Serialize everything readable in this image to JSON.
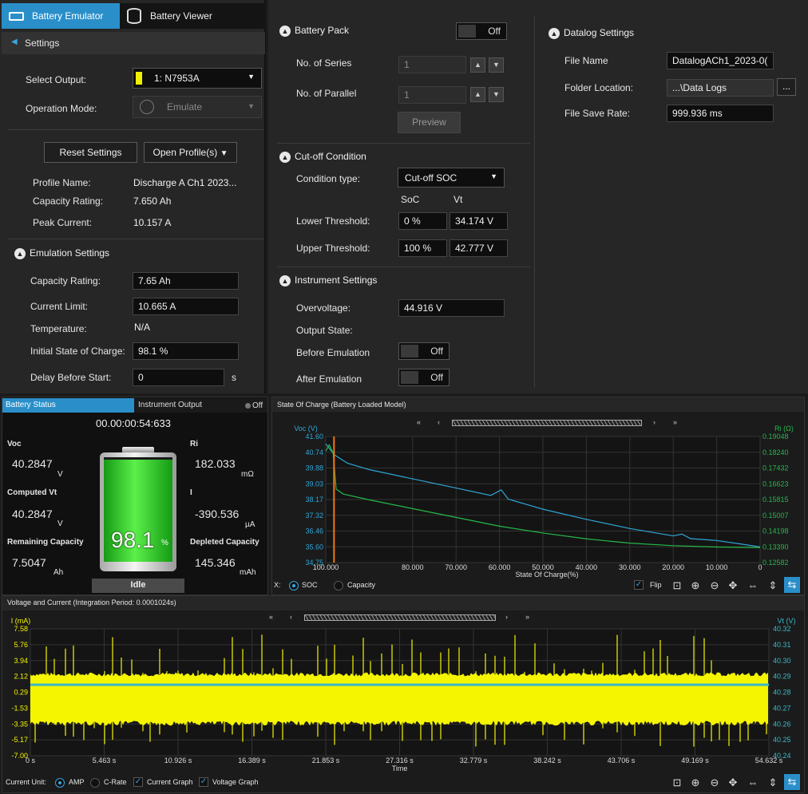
{
  "tabs": {
    "emulator": "Battery Emulator",
    "viewer": "Battery Viewer"
  },
  "settings": {
    "title": "Settings",
    "select_output_label": "Select Output:",
    "select_output_value": "1: N7953A",
    "operation_mode_label": "Operation Mode:",
    "operation_mode_value": "Emulate",
    "reset_button": "Reset Settings",
    "open_profiles_button": "Open Profile(s)",
    "profile_name_label": "Profile Name:",
    "profile_name_value": "Discharge A Ch1 2023...",
    "capacity_rating_label": "Capacity Rating:",
    "capacity_rating_value": "7.650 Ah",
    "peak_current_label": "Peak Current:",
    "peak_current_value": "10.157 A"
  },
  "emulation": {
    "title": "Emulation Settings",
    "capacity_label": "Capacity Rating:",
    "capacity_value": "7.65 Ah",
    "current_limit_label": "Current Limit:",
    "current_limit_value": "10.665 A",
    "temperature_label": "Temperature:",
    "temperature_value": "N/A",
    "initial_soc_label": "Initial State of Charge:",
    "initial_soc_value": "98.1 %",
    "delay_label": "Delay Before Start:",
    "delay_value": "0",
    "delay_unit": "s"
  },
  "pack": {
    "title": "Battery Pack",
    "toggle": "Off",
    "series_label": "No. of Series",
    "series_value": "1",
    "parallel_label": "No. of Parallel",
    "parallel_value": "1",
    "preview_button": "Preview"
  },
  "cutoff": {
    "title": "Cut-off Condition",
    "condition_label": "Condition type:",
    "condition_value": "Cut-off SOC",
    "soc_header": "SoC",
    "vt_header": "Vt",
    "lower_label": "Lower Threshold:",
    "lower_soc": "0 %",
    "lower_vt": "34.174 V",
    "upper_label": "Upper Threshold:",
    "upper_soc": "100 %",
    "upper_vt": "42.777 V"
  },
  "instrument": {
    "title": "Instrument Settings",
    "overvoltage_label": "Overvoltage:",
    "overvoltage_value": "44.916 V",
    "output_state_label": "Output State:",
    "before_label": "Before Emulation",
    "before_value": "Off",
    "after_label": "After Emulation",
    "after_value": "Off"
  },
  "datalog": {
    "title": "Datalog Settings",
    "file_name_label": "File Name",
    "file_name_value": "DatalogACh1_2023-0(",
    "folder_label": "Folder Location:",
    "folder_value": "...\\Data Logs",
    "browse_button": "...",
    "rate_label": "File Save Rate:",
    "rate_value": "999.936 ms"
  },
  "status": {
    "tab_status": "Battery Status",
    "tab_instrument": "Instrument Output",
    "off_label": "Off",
    "timer": "00.00:00:54:633",
    "voc_label": "Voc",
    "voc_value": "40.2847",
    "voc_unit": "V",
    "cvt_label": "Computed Vt",
    "cvt_value": "40.2847",
    "cvt_unit": "V",
    "rem_label": "Remaining Capacity",
    "rem_value": "7.5047",
    "rem_unit": "Ah",
    "ri_label": "Ri",
    "ri_value": "182.033",
    "ri_unit": "mΩ",
    "i_label": "I",
    "i_value": "-390.536",
    "i_unit": "µA",
    "dep_label": "Depleted Capacity",
    "dep_value": "145.346",
    "dep_unit": "mAh",
    "soc_percent": "98.1",
    "soc_sign": "%",
    "soc_fill": 0.981,
    "state": "Idle"
  },
  "soc_chart": {
    "title": "State Of Charge (Battery Loaded Model)",
    "left_axis": "Voc (V)",
    "right_axis": "Ri (Ω)",
    "x_title": "State Of Charge(%)",
    "x_label": "X:",
    "opt_soc": "SOC",
    "opt_capacity": "Capacity",
    "flip_label": "Flip"
  },
  "vi_chart": {
    "title": "Voltage and Current (Integration Period: 0.0001024s)",
    "left_axis": "I (mA)",
    "right_axis": "Vt (V)",
    "x_title": "Time",
    "unit_label": "Current Unit:",
    "opt_amp": "AMP",
    "opt_crate": "C-Rate",
    "chk_current": "Current Graph",
    "chk_voltage": "Voltage Graph"
  },
  "colors": {
    "accent": "#1e9ad6",
    "voc": "#2fa6d6",
    "ri": "#26b84a",
    "current": "#f5f500",
    "voltage": "#38b8c8",
    "marker": "#f07a10"
  },
  "chart_data": [
    {
      "type": "line",
      "title": "State Of Charge (Battery Loaded Model)",
      "xlabel": "State Of Charge(%)",
      "ylabel": "Voc (V)",
      "y2label": "Ri (Ω)",
      "x_ticks": [
        "100.000",
        "80.000",
        "70.000",
        "60.000",
        "50.000",
        "40.000",
        "30.000",
        "20.000",
        "10.000",
        "0"
      ],
      "y_ticks": [
        "41.60",
        "40.74",
        "39.88",
        "39.03",
        "38.17",
        "37.32",
        "36.46",
        "35.60",
        "34.75"
      ],
      "y2_ticks": [
        "0.19048",
        "0.18240",
        "0.17432",
        "0.16623",
        "0.15815",
        "0.15007",
        "0.14198",
        "0.13390",
        "0.12582"
      ],
      "xlim": [
        100,
        0
      ],
      "ylim": [
        34.75,
        41.6
      ],
      "y2lim": [
        0.12582,
        0.19048
      ],
      "grid": true,
      "series": [
        {
          "name": "Voc (V)",
          "axis": "left",
          "x": [
            100,
            98,
            95,
            90,
            80,
            70,
            62,
            59.6,
            58,
            50,
            40,
            30,
            20,
            18,
            16,
            10,
            5,
            0
          ],
          "y": [
            41.2,
            40.6,
            40.15,
            39.8,
            39.3,
            38.8,
            38.4,
            38.7,
            38.2,
            37.65,
            37.1,
            36.6,
            36.2,
            36.3,
            36.05,
            35.95,
            35.78,
            35.6
          ]
        },
        {
          "name": "Ri (Ω)",
          "axis": "right",
          "x": [
            100,
            99.2,
            98.3,
            97.6,
            96,
            90,
            80,
            70,
            60,
            50,
            40,
            30,
            20,
            10,
            0
          ],
          "y": [
            0.183,
            0.1862,
            0.182,
            0.1635,
            0.161,
            0.158,
            0.1535,
            0.149,
            0.1445,
            0.141,
            0.138,
            0.1358,
            0.1345,
            0.1338,
            0.1335
          ]
        }
      ],
      "marker_x": 98.1
    },
    {
      "type": "line",
      "title": "Voltage and Current (Integration Period: 0.0001024s)",
      "xlabel": "Time",
      "ylabel": "I (mA)",
      "y2label": "Vt (V)",
      "x_ticks": [
        "0 s",
        "5.463 s",
        "10.926 s",
        "16.389 s",
        "21.853 s",
        "27.316 s",
        "32.779 s",
        "38.242 s",
        "43.706 s",
        "49.169 s",
        "54.632 s"
      ],
      "y_ticks": [
        "7.58",
        "5.76",
        "3.94",
        "2.12",
        "0.29",
        "-1.53",
        "-3.35",
        "-5.17",
        "-7.00"
      ],
      "y2_ticks": [
        "40.32",
        "40.31",
        "40.30",
        "40.29",
        "40.28",
        "40.27",
        "40.26",
        "40.25",
        "40.24"
      ],
      "xlim": [
        0,
        54.632
      ],
      "ylim": [
        -7.0,
        7.58
      ],
      "y2lim": [
        40.24,
        40.32
      ],
      "grid": true,
      "series": [
        {
          "name": "I (mA)",
          "axis": "left",
          "band_upper": 2.12,
          "band_lower": -3.0,
          "spike_max": 7.0,
          "spike_min": -6.0
        },
        {
          "name": "Vt (V)",
          "axis": "right",
          "value": 40.2847
        }
      ]
    }
  ]
}
